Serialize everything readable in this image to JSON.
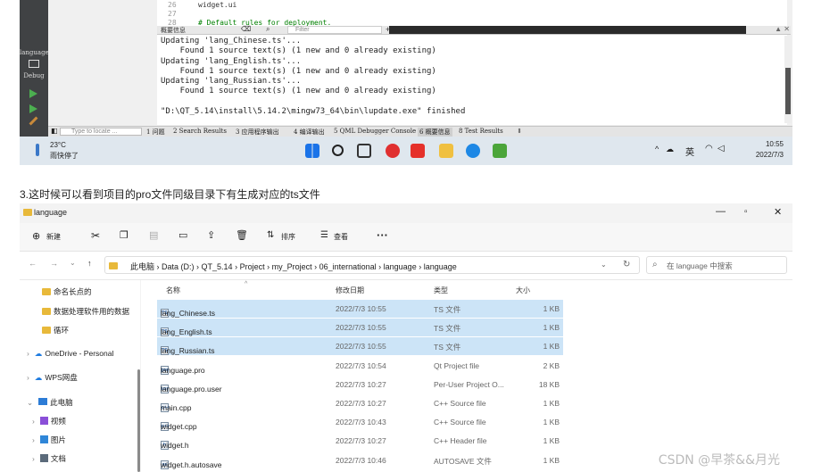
{
  "qt": {
    "sidebar": {
      "language": "language",
      "debug": "Debug"
    },
    "code_lines": [
      {
        "n": "26",
        "t": "widget.ui"
      },
      {
        "n": "27",
        "t": ""
      },
      {
        "n": "28",
        "t": "# Default rules for deployment."
      }
    ],
    "panel": {
      "title": "概要信息",
      "filter_placeholder": "Filter"
    },
    "output": [
      "Updating 'lang_Chinese.ts'...",
      "    Found 1 source text(s) (1 new and 0 already existing)",
      "Updating 'lang_English.ts'...",
      "    Found 1 source text(s) (1 new and 0 already existing)",
      "Updating 'lang_Russian.ts'...",
      "    Found 1 source text(s) (1 new and 0 already existing)",
      "",
      "\"D:\\QT_5.14\\install\\5.14.2\\mingw73_64\\bin\\lupdate.exe\" finished"
    ],
    "bottom": {
      "locate_placeholder": "Type to locate ...",
      "tabs": [
        "1 问题",
        "2 Search Results",
        "3 应用程序输出",
        "4 编译输出",
        "5 QML Debugger Console",
        "6 概要信息",
        "8 Test Results"
      ]
    }
  },
  "taskbar": {
    "weather_temp": "23°C",
    "weather_desc": "雨快停了",
    "ime": "英",
    "time": "10:55",
    "date": "2022/7/3"
  },
  "caption": "3.这时候可以看到项目的pro文件同级目录下有生成对应的ts文件",
  "explorer": {
    "title": "language",
    "toolbar": {
      "new": "新建",
      "sort": "排序",
      "view": "查看",
      "more": "···"
    },
    "breadcrumb": [
      "此电脑",
      "Data (D:)",
      "QT_5.14",
      "Project",
      "my_Project",
      "06_international",
      "language",
      "language"
    ],
    "search_placeholder": "在 language 中搜索",
    "nav": [
      {
        "label": "命名长点的",
        "kind": "folder"
      },
      {
        "label": "数据处理软件用的数据",
        "kind": "folder"
      },
      {
        "label": "循环",
        "kind": "folder"
      },
      {
        "label": "OneDrive - Personal",
        "kind": "cloud"
      },
      {
        "label": "WPS网盘",
        "kind": "cloud"
      },
      {
        "label": "此电脑",
        "kind": "pc"
      },
      {
        "label": "视频",
        "kind": "video"
      },
      {
        "label": "图片",
        "kind": "pic"
      },
      {
        "label": "文档",
        "kind": "doc"
      }
    ],
    "columns": {
      "name": "名称",
      "date": "修改日期",
      "type": "类型",
      "size": "大小"
    },
    "files": [
      {
        "icon": "TS",
        "name": "lang_Chinese.ts",
        "date": "2022/7/3 10:55",
        "type": "TS 文件",
        "size": "1 KB",
        "selected": true
      },
      {
        "icon": "TS",
        "name": "lang_English.ts",
        "date": "2022/7/3 10:55",
        "type": "TS 文件",
        "size": "1 KB",
        "selected": true
      },
      {
        "icon": "TS",
        "name": "lang_Russian.ts",
        "date": "2022/7/3 10:55",
        "type": "TS 文件",
        "size": "1 KB",
        "selected": true
      },
      {
        "icon": "pro",
        "name": "language.pro",
        "date": "2022/7/3 10:54",
        "type": "Qt Project file",
        "size": "2 KB",
        "selected": false
      },
      {
        "icon": "usr",
        "name": "language.pro.user",
        "date": "2022/7/3 10:27",
        "type": "Per-User Project O...",
        "size": "18 KB",
        "selected": false
      },
      {
        "icon": "c++",
        "name": "main.cpp",
        "date": "2022/7/3 10:27",
        "type": "C++ Source file",
        "size": "1 KB",
        "selected": false
      },
      {
        "icon": "c++",
        "name": "widget.cpp",
        "date": "2022/7/3 10:43",
        "type": "C++ Source file",
        "size": "1 KB",
        "selected": false
      },
      {
        "icon": "h",
        "name": "widget.h",
        "date": "2022/7/3 10:27",
        "type": "C++ Header file",
        "size": "1 KB",
        "selected": false
      },
      {
        "icon": "as",
        "name": "widget.h.autosave",
        "date": "2022/7/3 10:46",
        "type": "AUTOSAVE 文件",
        "size": "1 KB",
        "selected": false
      }
    ]
  },
  "watermark": "CSDN @早茶&&月光"
}
